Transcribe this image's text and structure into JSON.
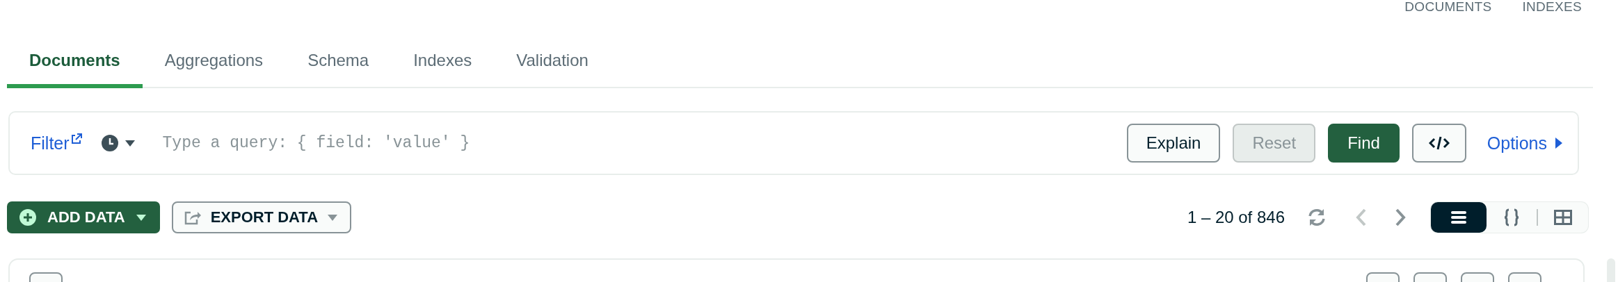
{
  "header": {
    "links": [
      {
        "label": "DOCUMENTS"
      },
      {
        "label": "INDEXES"
      }
    ]
  },
  "tabs": [
    {
      "label": "Documents",
      "selected": true
    },
    {
      "label": "Aggregations",
      "selected": false
    },
    {
      "label": "Schema",
      "selected": false
    },
    {
      "label": "Indexes",
      "selected": false
    },
    {
      "label": "Validation",
      "selected": false
    }
  ],
  "query_bar": {
    "filter_label": "Filter",
    "placeholder": "Type a query: { field: 'value' }",
    "buttons": [
      {
        "label": "Explain",
        "kind": "outline",
        "disabled": false
      },
      {
        "label": "Reset",
        "kind": "outline",
        "disabled": true
      },
      {
        "label": "Find",
        "kind": "primary",
        "disabled": false
      }
    ],
    "options_label": "Options"
  },
  "toolbar": {
    "add_data": "ADD DATA",
    "export_data": "EXPORT DATA",
    "pagination": "1 – 20 of 846",
    "prev_disabled": true,
    "next_disabled": false,
    "view_modes": [
      {
        "kind": "list",
        "selected": true
      },
      {
        "kind": "json",
        "selected": false
      },
      {
        "kind": "table",
        "selected": false
      }
    ]
  }
}
